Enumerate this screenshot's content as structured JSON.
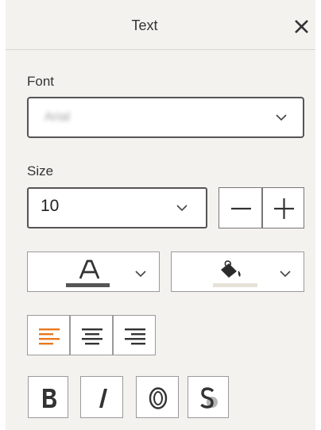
{
  "panel": {
    "title": "Text"
  },
  "font": {
    "label": "Font",
    "value": "Arial"
  },
  "size": {
    "label": "Size",
    "value": "10"
  },
  "colors": {
    "text_color_underline": "#555555",
    "highlight_underline": "#e6e2d8",
    "align_active": "#e8781e",
    "icon_dark": "#333333"
  },
  "icons": {
    "close": "close-icon",
    "chevron": "chevron-down-icon",
    "minus": "minus-icon",
    "plus": "plus-icon",
    "font_color": "font-color-icon",
    "highlight": "paint-bucket-icon",
    "align_left": "align-left-icon",
    "align_center": "align-center-icon",
    "align_right": "align-right-icon",
    "bold": "bold-icon",
    "italic": "italic-icon",
    "outline": "outline-icon",
    "shadow": "shadow-icon"
  },
  "alignment": {
    "selected": "left"
  }
}
